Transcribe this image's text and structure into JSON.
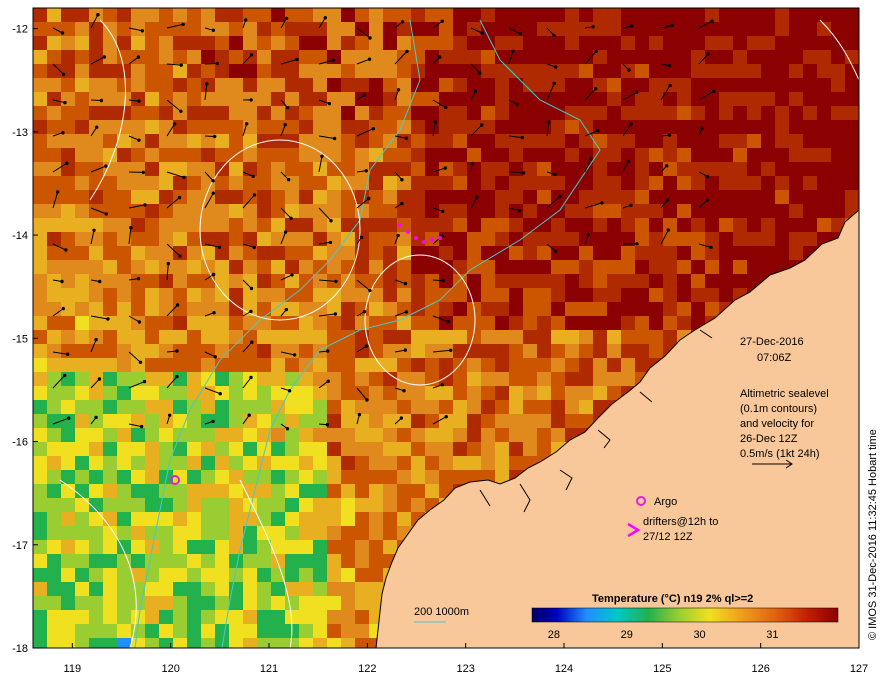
{
  "map": {
    "lon_range": [
      118.6,
      127.0
    ],
    "lat_range": [
      -18.0,
      -11.8
    ],
    "x_ticks": [
      "119",
      "120",
      "121",
      "122",
      "123",
      "124",
      "125",
      "126",
      "127"
    ],
    "y_ticks": [
      "-12",
      "-13",
      "-14",
      "-15",
      "-16",
      "-17",
      "-18"
    ],
    "land_color": "#f9c89a",
    "sea_palette": [
      "#8b0000",
      "#b02a00",
      "#cc5500",
      "#e08a1e",
      "#e8b020",
      "#f0e020",
      "#9acd32",
      "#22b14c",
      "#1e90ff",
      "#000080"
    ]
  },
  "annotation": {
    "date": "27-Dec-2016",
    "time": "07:06Z",
    "altimetry": [
      "Altimetric sealevel",
      "(0.1m contours)",
      "and velocity for",
      "26-Dec 12Z",
      "0.5m/s (1kt 24h)"
    ],
    "argo_label": "Argo",
    "drifters_label": [
      "drifters@12h to",
      "27/12 12Z"
    ],
    "depth_label": "200  1000m"
  },
  "colorbar": {
    "title": "Temperature (°C) n19 2% ql>=2",
    "ticks": [
      "28",
      "29",
      "30",
      "31"
    ],
    "colors": [
      "#000060",
      "#0000c0",
      "#1e90ff",
      "#00c8c8",
      "#22b14c",
      "#9acd32",
      "#f0e020",
      "#f0a020",
      "#e06010",
      "#c02000",
      "#8b0000"
    ]
  },
  "credit": "© IMOS 31-Dec-2016 11:32:45 Hobart time",
  "colors": {
    "argo": "#e020e0",
    "drifter": "#ff00ff",
    "isobath": "#4ac8c8",
    "contour": "#ffffff"
  }
}
